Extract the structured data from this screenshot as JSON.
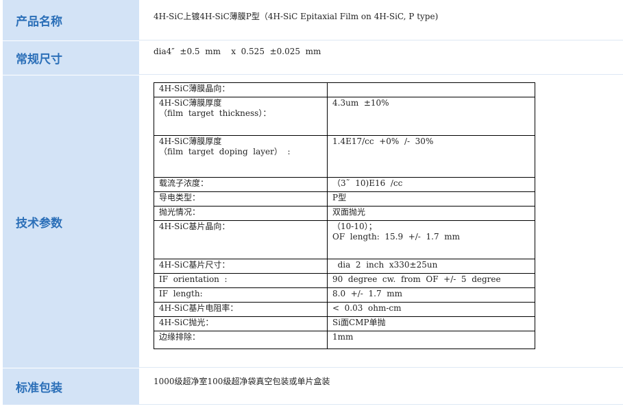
{
  "sections": {
    "name": {
      "label": "产品名称",
      "value": "4H-SiC上镀4H-SiC薄膜P型（4H-SiC Epitaxial Film on 4H-SiC, P type)"
    },
    "size": {
      "label": "常规尺寸",
      "value": "dia4″  ±0.5  mm    x  0.525  ±0.025  mm"
    },
    "tech": {
      "label": "技术参数"
    },
    "packaging": {
      "label": "标准包装",
      "value": "1000级超净室100级超净袋真空包装或单片盒装"
    }
  },
  "params": [
    {
      "key": "4H-SiC薄膜晶向：",
      "value": ""
    },
    {
      "key": "4H-SiC薄膜厚度\n（film  target  thickness）：",
      "value": "4.3um  ±10%"
    },
    {
      "key": "4H-SiC薄膜厚度\n（film  target  doping  layer）  :",
      "value": "1.4E17/cc  +0%  /-  30%"
    },
    {
      "key": "载流子浓度：",
      "value": "（3˜  10)E16  /cc"
    },
    {
      "key": "导电类型：",
      "value": "P型"
    },
    {
      "key": "抛光情况：",
      "value": "双面抛光"
    },
    {
      "key": "4H-SiC基片晶向：",
      "value": "（10-10）；\nOF  length:  15.9  +/-  1.7  mm"
    },
    {
      "key": "4H-SiC基片尺寸：",
      "value": "  dia  2  inch  x330±25un"
    },
    {
      "key": "IF  orientation  :",
      "value": "90  degree  cw.  from  OF  +/-  5  degree"
    },
    {
      "key": "IF  length:",
      "value": "8.0  +/-  1.7  mm"
    },
    {
      "key": "4H-SiC基片电阻率：",
      "value": "<  0.03  ohm-cm"
    },
    {
      "key": "4H-SiC抛光：",
      "value": "Si面CMP单抛"
    },
    {
      "key": "边缘排除：",
      "value": "1mm"
    }
  ]
}
